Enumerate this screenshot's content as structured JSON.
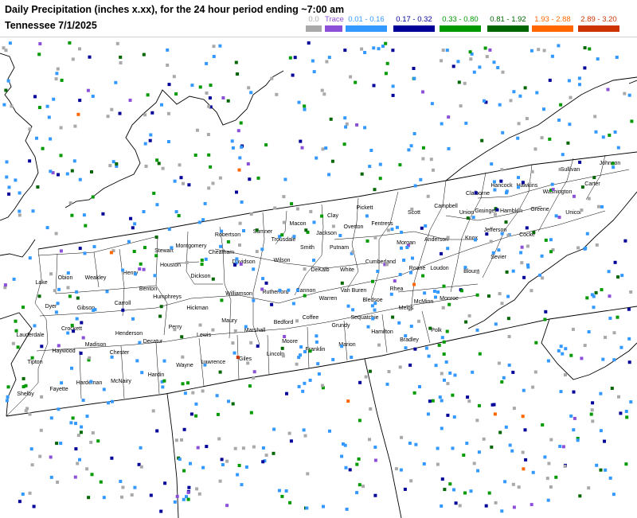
{
  "title_line1": "Daily Precipitation (inches  x.xx),  for the 24 hour period ending ~7:00 am",
  "title_line2": "Tennessee 7/1/2025",
  "legend": [
    {
      "label": "0.0",
      "color": "#a9a9a9"
    },
    {
      "label": "Trace",
      "color": "#8c4fd8"
    },
    {
      "label": "0.01 - 0.16",
      "color": "#3399ff"
    },
    {
      "label": "0.17 - 0.32",
      "color": "#000099"
    },
    {
      "label": "0.33 - 0.80",
      "color": "#009900"
    },
    {
      "label": "0.81 - 1.92",
      "color": "#006600"
    },
    {
      "label": "1.93 - 2.88",
      "color": "#ff6600"
    },
    {
      "label": "2.89 - 3.20",
      "color": "#cc3300"
    }
  ],
  "counties": [
    "Obion",
    "Weakley",
    "Henry",
    "Stewart",
    "Montgomery",
    "Robertson",
    "Sumner",
    "Macon",
    "Clay",
    "Pickett",
    "Scott",
    "Campbell",
    "Claiborne",
    "Hancock",
    "Hawkins",
    "Sullivan",
    "Johnson",
    "Carter",
    "Washington",
    "Unicoi",
    "Greene",
    "Hamblen",
    "Grainger",
    "Union",
    "Jefferson",
    "Cocke",
    "Sevier",
    "Knox",
    "Blount",
    "Anderson",
    "Morgan",
    "Fentress",
    "Overton",
    "Jackson",
    "Smith",
    "Trousdale",
    "Wilson",
    "Davidson",
    "Cheatham",
    "Houston",
    "Benton",
    "Carroll",
    "Gibson",
    "Dyer",
    "Lake",
    "Lauderdale",
    "Crockett",
    "Haywood",
    "Madison",
    "Tipton",
    "Shelby",
    "Fayette",
    "Hardeman",
    "Chester",
    "McNairy",
    "Hardin",
    "Henderson",
    "Decatur",
    "Perry",
    "Humphreys",
    "Dickson",
    "Hickman",
    "Lewis",
    "Wayne",
    "Lawrence",
    "Giles",
    "Maury",
    "Williamson",
    "Rutherford",
    "Marshall",
    "Bedford",
    "Lincoln",
    "Franklin",
    "Coffee",
    "Moore",
    "Cannon",
    "DeKalb",
    "Putnam",
    "White",
    "Warren",
    "Van Buren",
    "Cumberland",
    "Roane",
    "Rhea",
    "Meigs",
    "McMinn",
    "Monroe",
    "Loudon",
    "Bledsoe",
    "Sequatchie",
    "Grundy",
    "Marion",
    "Hamilton",
    "Bradley",
    "Polk"
  ]
}
